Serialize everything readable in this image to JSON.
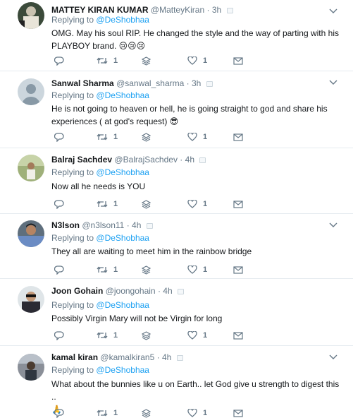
{
  "replying_prefix": "Replying to",
  "tweets": [
    {
      "name": "MATTEY KIRAN KUMAR",
      "handle": "@MatteyKiran",
      "time": "3h",
      "reply_to": "@DeShobhaa",
      "text": "OMG. May his soul RIP. He changed the style and the way of parting with his PLAYBOY brand.",
      "emoji": "😢😢😢",
      "retweets": "1",
      "likes": "1"
    },
    {
      "name": "Sanwal Sharma",
      "handle": "@sanwal_sharma",
      "time": "3h",
      "reply_to": "@DeShobhaa",
      "text": "He is not going to heaven or hell, he is going straight to god and share his experiences ( at god's request)",
      "emoji": "😎",
      "retweets": "1",
      "likes": "1"
    },
    {
      "name": "Balraj Sachdev",
      "handle": "@BalrajSachdev",
      "time": "4h",
      "reply_to": "@DeShobhaa",
      "text": "Now all he needs is YOU",
      "emoji": "",
      "retweets": "1",
      "likes": "1"
    },
    {
      "name": "N3lson",
      "handle": "@n3lson11",
      "time": "4h",
      "reply_to": "@DeShobhaa",
      "text": "They all are waiting to meet him in the rainbow bridge",
      "emoji": "",
      "retweets": "1",
      "likes": "1"
    },
    {
      "name": "Joon Gohain",
      "handle": "@joongohain",
      "time": "4h",
      "reply_to": "@DeShobhaa",
      "text": "Possibly Virgin Mary will not be Virgin for long",
      "emoji": "",
      "retweets": "1",
      "likes": "1"
    },
    {
      "name": "kamal kiran",
      "handle": "@kamalkiran5",
      "time": "4h",
      "reply_to": "@DeShobhaa",
      "text": "What about the bunnies like u on Earth.. let God give u strength to digest this ..",
      "emoji": "🙏",
      "retweets": "1",
      "likes": "1"
    }
  ]
}
